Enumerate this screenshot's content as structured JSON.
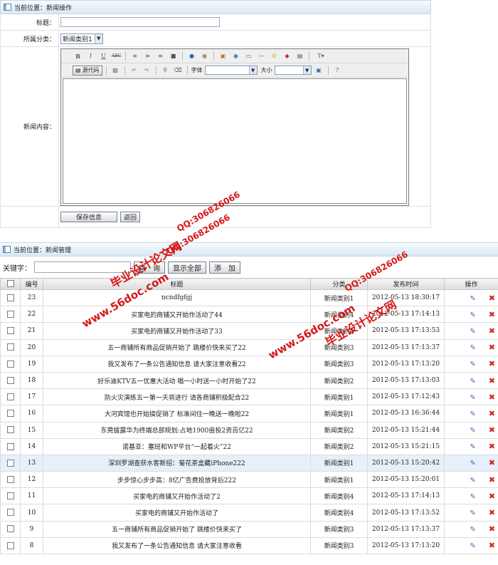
{
  "top_panel": {
    "location": "当前位置：新闻操作",
    "title_label": "标题：",
    "category_label": "所属分类：",
    "category_selected": "新闻类别1",
    "content_label": "新闻内容：",
    "editor": {
      "source_button": "源代码",
      "font_label": "字体",
      "size_label": "大小"
    },
    "save_button": "保存信息",
    "back_button": "返回"
  },
  "bottom_panel": {
    "location": "当前位置：新闻管理",
    "keyword_label": "关键字：",
    "query_button": "查　询",
    "show_all_button": "显示全部",
    "add_button": "添　加",
    "columns": {
      "id": "编号",
      "title": "标题",
      "category": "分类",
      "time": "发布时间",
      "ops": "操作"
    },
    "rows": [
      {
        "id": "23",
        "title": "ncndfgfgj",
        "category": "新闻类别1",
        "time": "2012-05-13 18:30:17"
      },
      {
        "id": "22",
        "title": "买家电的商铺又开始作活动了44",
        "category": "新闻类别4",
        "time": "2012-05-13 17:14:13"
      },
      {
        "id": "21",
        "title": "买家电的商铺又开始作活动了33",
        "category": "新闻类别4",
        "time": "2012-05-13 17:13:53"
      },
      {
        "id": "20",
        "title": "五一商铺所有商品促销开始了 跳楼价快来买了22",
        "category": "新闻类别3",
        "time": "2012-05-13 17:13:37"
      },
      {
        "id": "19",
        "title": "我又发布了一条公告通知信息 请大家注意收看22",
        "category": "新闻类别3",
        "time": "2012-05-13 17:13:20"
      },
      {
        "id": "18",
        "title": "好乐迪KTV五一优惠大活动 唱一小时送一小时开始了22",
        "category": "新闻类别2",
        "time": "2012-05-13 17:13:03"
      },
      {
        "id": "17",
        "title": "防火灾演练五一第一天将进行 请各商铺积极配合22",
        "category": "新闻类别1",
        "time": "2012-05-13 17:12:43"
      },
      {
        "id": "16",
        "title": "大河宾馆也开始搞促销了 标准间住一晚送一晚啦22",
        "category": "新闻类别1",
        "time": "2012-05-13 16:36:44"
      },
      {
        "id": "15",
        "title": "东莞拔露华为终端总部规划:占地1900亩投2资百亿22",
        "category": "新闻类别2",
        "time": "2012-05-13 15:21:44"
      },
      {
        "id": "14",
        "title": "诺基亚：塞班和WP平台“一起着火”22",
        "category": "新闻类别2",
        "time": "2012-05-13 15:21:15"
      },
      {
        "id": "13",
        "title": "深圳罗湖查获水客新招：菊花茶盒藏iPhone222",
        "category": "新闻类别1",
        "time": "2012-05-13 15:20:42"
      },
      {
        "id": "12",
        "title": "步步惊心步步高：8亿广告费投放背后222",
        "category": "新闻类别1",
        "time": "2012-05-13 15:20:01"
      },
      {
        "id": "11",
        "title": "买家电的商铺又开始作活动了2",
        "category": "新闻类别4",
        "time": "2012-05-13 17:14:13"
      },
      {
        "id": "10",
        "title": "买家电的商铺又开始作活动了",
        "category": "新闻类别4",
        "time": "2012-05-13 17:13:52"
      },
      {
        "id": "9",
        "title": "五一商铺所有商品促销开始了 跳楼价快来买了",
        "category": "新闻类别3",
        "time": "2012-05-13 17:13:37"
      },
      {
        "id": "8",
        "title": "我又发布了一条公告通知信息 请大家注意收看",
        "category": "新闻类别3",
        "time": "2012-05-13 17:13:20"
      }
    ]
  },
  "watermarks": {
    "site": "毕业设计论文网",
    "url": "www.56doc.com",
    "qq": "QQ:306826066"
  },
  "colors": {
    "delete": "#d02626",
    "edit": "#3b6fb6",
    "watermark": "#d51818",
    "highlight_row": "#e6f0fa"
  }
}
